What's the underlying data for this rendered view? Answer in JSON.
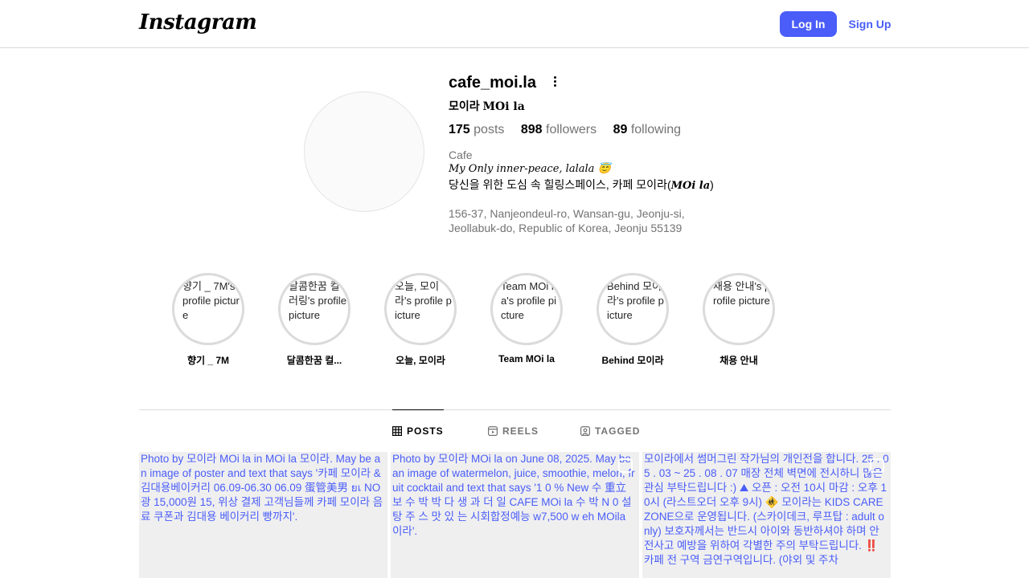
{
  "header": {
    "logo": "Instagram",
    "login_label": "Log In",
    "signup_label": "Sign Up"
  },
  "profile": {
    "username": "cafe_moi.la",
    "fullname_ko": "모이라 ",
    "fullname_latin": "MOi la",
    "stats": {
      "posts_count": "175",
      "posts_label": " posts",
      "followers_count": "898",
      "followers_label": " followers",
      "following_count": "89",
      "following_label": " following"
    },
    "category": "Cafe",
    "bio_line1": "My Only inner-peace, lalala 😇",
    "bio_line2_ko": "당신을 위한 도심 속 힐링스페이스, 카페 모이라(",
    "bio_line2_latin": "MOi la",
    "bio_line2_end": ")",
    "address": "156-37, Nanjeondeul-ro, Wansan-gu, Jeonju-si, Jeollabuk-do, Republic of Korea, Jeonju 55139"
  },
  "highlights": [
    {
      "alt": "향기 _ 7M's profile picture",
      "label": "향기 _ 7M"
    },
    {
      "alt": "달콤한꿈 컬러링's profile picture",
      "label": "달콤한꿈 컬..."
    },
    {
      "alt": "오늘, 모이라's profile picture",
      "label": "오늘, 모이라"
    },
    {
      "alt": "Team MOi la's profile picture",
      "label": "Team MOi la"
    },
    {
      "alt": "Behind 모이라's profile picture",
      "label": "Behind 모이라"
    },
    {
      "alt": "채용 안내's profile picture",
      "label": "채용 안내"
    }
  ],
  "tabs": [
    {
      "label": "POSTS",
      "icon": "grid-icon",
      "active": true
    },
    {
      "label": "REELS",
      "icon": "reels-icon",
      "active": false
    },
    {
      "label": "TAGGED",
      "icon": "tagged-icon",
      "active": false
    }
  ],
  "posts": [
    {
      "alt": "Photo by 모이라 MOi la in MOi la 모이라. May be an image of poster and text that says '카페 모이라 & 김대용베이커리 06.09-06.30 06.09 蛋管美男 ยเ NO 광 15,000원 15, 위상 결제 고객님들께 카페 모이라 음료 쿠폰과 김대용 베이커리 빵까지'."
    },
    {
      "alt": "Photo by 모이라 MOi la on June 08, 2025. May be an image of watermelon, juice, smoothie, melon, fruit cocktail and text that says '1 0 % New 수 重立 보 수 박 박 다 생 과 더 일 CAFE MOi la 수 박 N 0 설 탕 주 스 맛 있 는 시회합정예능 w7,500 w eh MOila 이라'."
    },
    {
      "alt": "모이라에서 썸머그린 작가님의 개인전을 합니다. 25 . 05 . 03 ~ 25 . 08 . 07 매장 전체 벽면에 전시하니 많은 관심 부탁드립니다 :) ⛰ 오픈 : 오전 10시 마감 : 오후 10시 (라스트오더 오후 9시) 🚸 모이라는 KIDS CARE ZONE으로 운영됩니다. (스카이데크, 루프탑 : adult only) 보호자께서는 반드시 아이와 동반하셔야 하며 안전사고 예방을 위하여 각별한 주의 부탁드립니다. ‼️ 카페 전 구역 금연구역입니다. (야외 및 주차"
    }
  ]
}
